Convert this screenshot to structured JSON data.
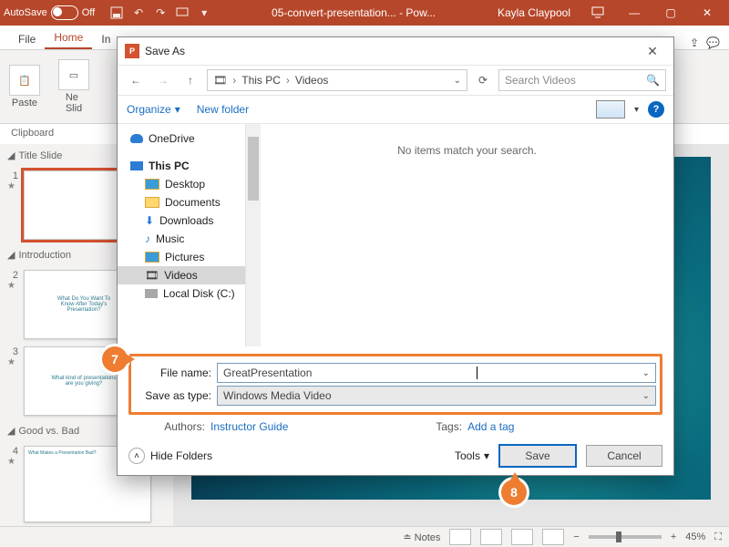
{
  "titlebar": {
    "autosave": "AutoSave",
    "autosave_state": "Off",
    "doc": "05-convert-presentation... - Pow...",
    "user": "Kayla Claypool"
  },
  "ribbon": {
    "file": "File",
    "home": "Home",
    "insert_initial": "In",
    "paste": "Paste",
    "new_slide": "Ne\nSlid",
    "clipboard_group": "Clipboard"
  },
  "panel": {
    "sections": [
      "Title Slide",
      "Introduction",
      "Good vs. Bad"
    ],
    "thumb2_line1": "What Do You Want To",
    "thumb2_line2": "Know After Today's",
    "thumb2_line3": "Presentation?",
    "thumb3_line1": "What kind of presentations",
    "thumb3_line2": "are you giving?",
    "thumb4_line": "What Makes a Presentation Bad?"
  },
  "dialog": {
    "title": "Save As",
    "path_root": "This PC",
    "path_leaf": "Videos",
    "search_placeholder": "Search Videos",
    "organize": "Organize",
    "new_folder": "New folder",
    "empty_msg": "No items match your search.",
    "tree": {
      "onedrive": "OneDrive",
      "thispc": "This PC",
      "desktop": "Desktop",
      "documents": "Documents",
      "downloads": "Downloads",
      "music": "Music",
      "pictures": "Pictures",
      "videos": "Videos",
      "localdisk": "Local Disk (C:)"
    },
    "file_name_label": "File name:",
    "file_name": "GreatPresentation",
    "save_type_label": "Save as type:",
    "save_type": "Windows Media Video",
    "authors_label": "Authors:",
    "authors": "Instructor Guide",
    "tags_label": "Tags:",
    "tags": "Add a tag",
    "hide_folders": "Hide Folders",
    "tools": "Tools",
    "save": "Save",
    "cancel": "Cancel"
  },
  "status": {
    "notes": "Notes",
    "zoom": "45%"
  },
  "badges": {
    "b7": "7",
    "b8": "8"
  }
}
